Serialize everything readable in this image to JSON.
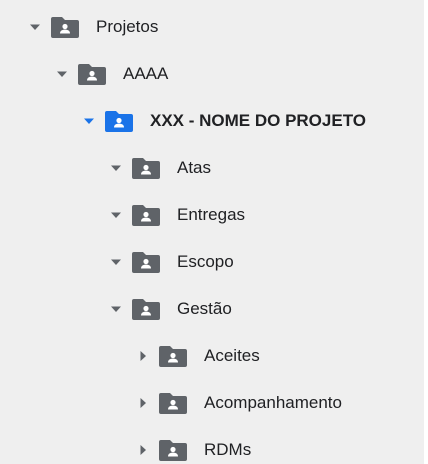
{
  "colors": {
    "panel_bg": "#efefef",
    "folder_gray": "#5f6368",
    "folder_selected": "#1a73e8",
    "caret_gray": "#5f6368",
    "text": "#202124"
  },
  "tree": {
    "items": [
      {
        "label": "Projetos",
        "depth": 0,
        "expanded": true,
        "selected": false,
        "icon": "shared-folder-icon"
      },
      {
        "label": "AAAA",
        "depth": 1,
        "expanded": true,
        "selected": false,
        "icon": "shared-folder-icon"
      },
      {
        "label": "XXX - NOME DO PROJETO",
        "depth": 2,
        "expanded": true,
        "selected": true,
        "icon": "shared-folder-icon"
      },
      {
        "label": "Atas",
        "depth": 3,
        "expanded": true,
        "selected": false,
        "icon": "shared-folder-icon"
      },
      {
        "label": "Entregas",
        "depth": 3,
        "expanded": true,
        "selected": false,
        "icon": "shared-folder-icon"
      },
      {
        "label": "Escopo",
        "depth": 3,
        "expanded": true,
        "selected": false,
        "icon": "shared-folder-icon"
      },
      {
        "label": "Gestão",
        "depth": 3,
        "expanded": true,
        "selected": false,
        "icon": "shared-folder-icon"
      },
      {
        "label": "Aceites",
        "depth": 4,
        "expanded": false,
        "selected": false,
        "icon": "shared-folder-icon"
      },
      {
        "label": "Acompanhamento",
        "depth": 4,
        "expanded": false,
        "selected": false,
        "icon": "shared-folder-icon"
      },
      {
        "label": "RDMs",
        "depth": 4,
        "expanded": false,
        "selected": false,
        "icon": "shared-folder-icon"
      }
    ]
  }
}
